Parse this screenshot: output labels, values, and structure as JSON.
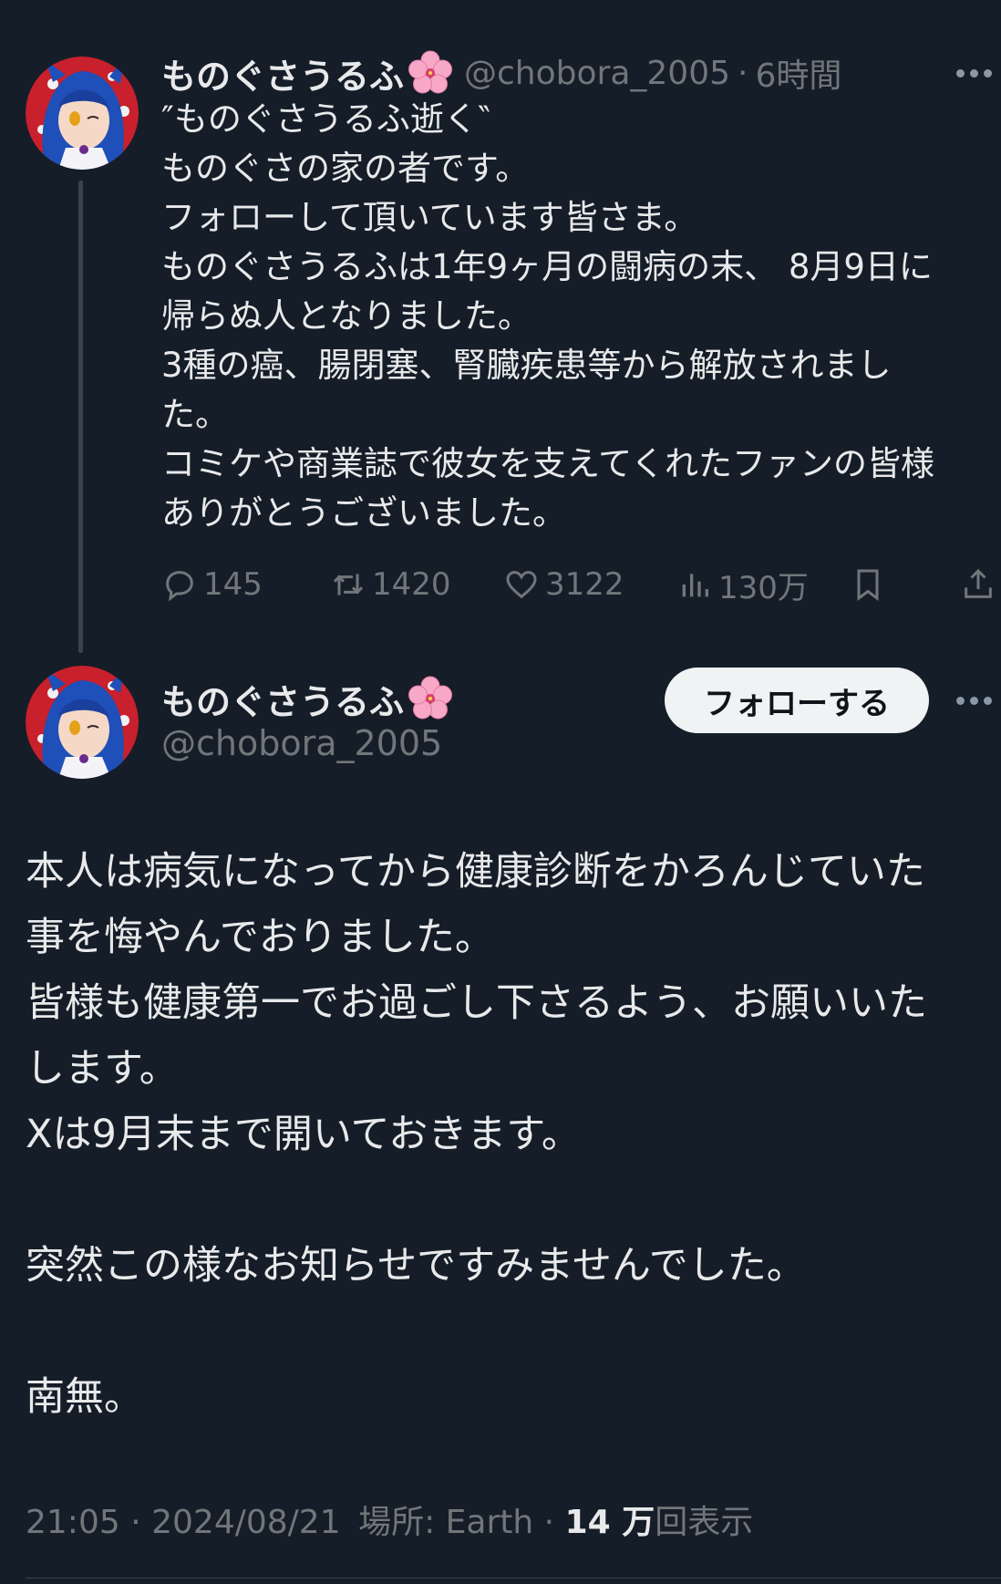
{
  "tweet1": {
    "display_name": "ものぐさうるふ",
    "handle": "@chobora_2005",
    "separator": "·",
    "time": "6時間",
    "lines": [
      "″ものぐさうるふ逝く‶",
      "ものぐさの家の者です。",
      "フォローして頂いています皆さま。",
      "ものぐさうるふは1年9ヶ月の闘病の末、 8月9日に",
      "帰らぬ人となりました。",
      "3種の癌、腸閉塞、腎臓疾患等から解放されまし",
      "た。",
      "コミケや商業誌で彼女を支えてくれたファンの皆様",
      "ありがとうございました。"
    ],
    "actions": {
      "replies": "145",
      "reposts": "1420",
      "likes": "3122",
      "views": "130万"
    }
  },
  "tweet2": {
    "display_name": "ものぐさうるふ",
    "handle": "@chobora_2005",
    "follow_label": "フォローする",
    "lines": [
      "本人は病気になってから健康診断をかろんじていた",
      "事を悔やんでおりました。",
      "皆様も健康第一でお過ごし下さるよう、お願いいた",
      "します。",
      "Xは9月末まで開いておきます。",
      "",
      "突然この様なお知らせですみませんでした。",
      "",
      "南無。"
    ],
    "footer": {
      "time": "21:05",
      "sep1": "·",
      "date": "2024/08/21",
      "location_label": "場所:",
      "location": "Earth",
      "sep2": "·",
      "views_count": "14 万",
      "views_label": "回表示"
    }
  },
  "icons": {
    "emoji": "cherry-blossom-icon",
    "reply": "reply-icon",
    "repost": "repost-icon",
    "like": "like-icon",
    "views": "views-icon",
    "bookmark": "bookmark-icon",
    "share": "share-icon",
    "more": "more-icon"
  },
  "colors": {
    "background": "#151d28",
    "text": "#e7e9ea",
    "muted": "#71767b",
    "follow_button_bg": "#eff3f4"
  }
}
